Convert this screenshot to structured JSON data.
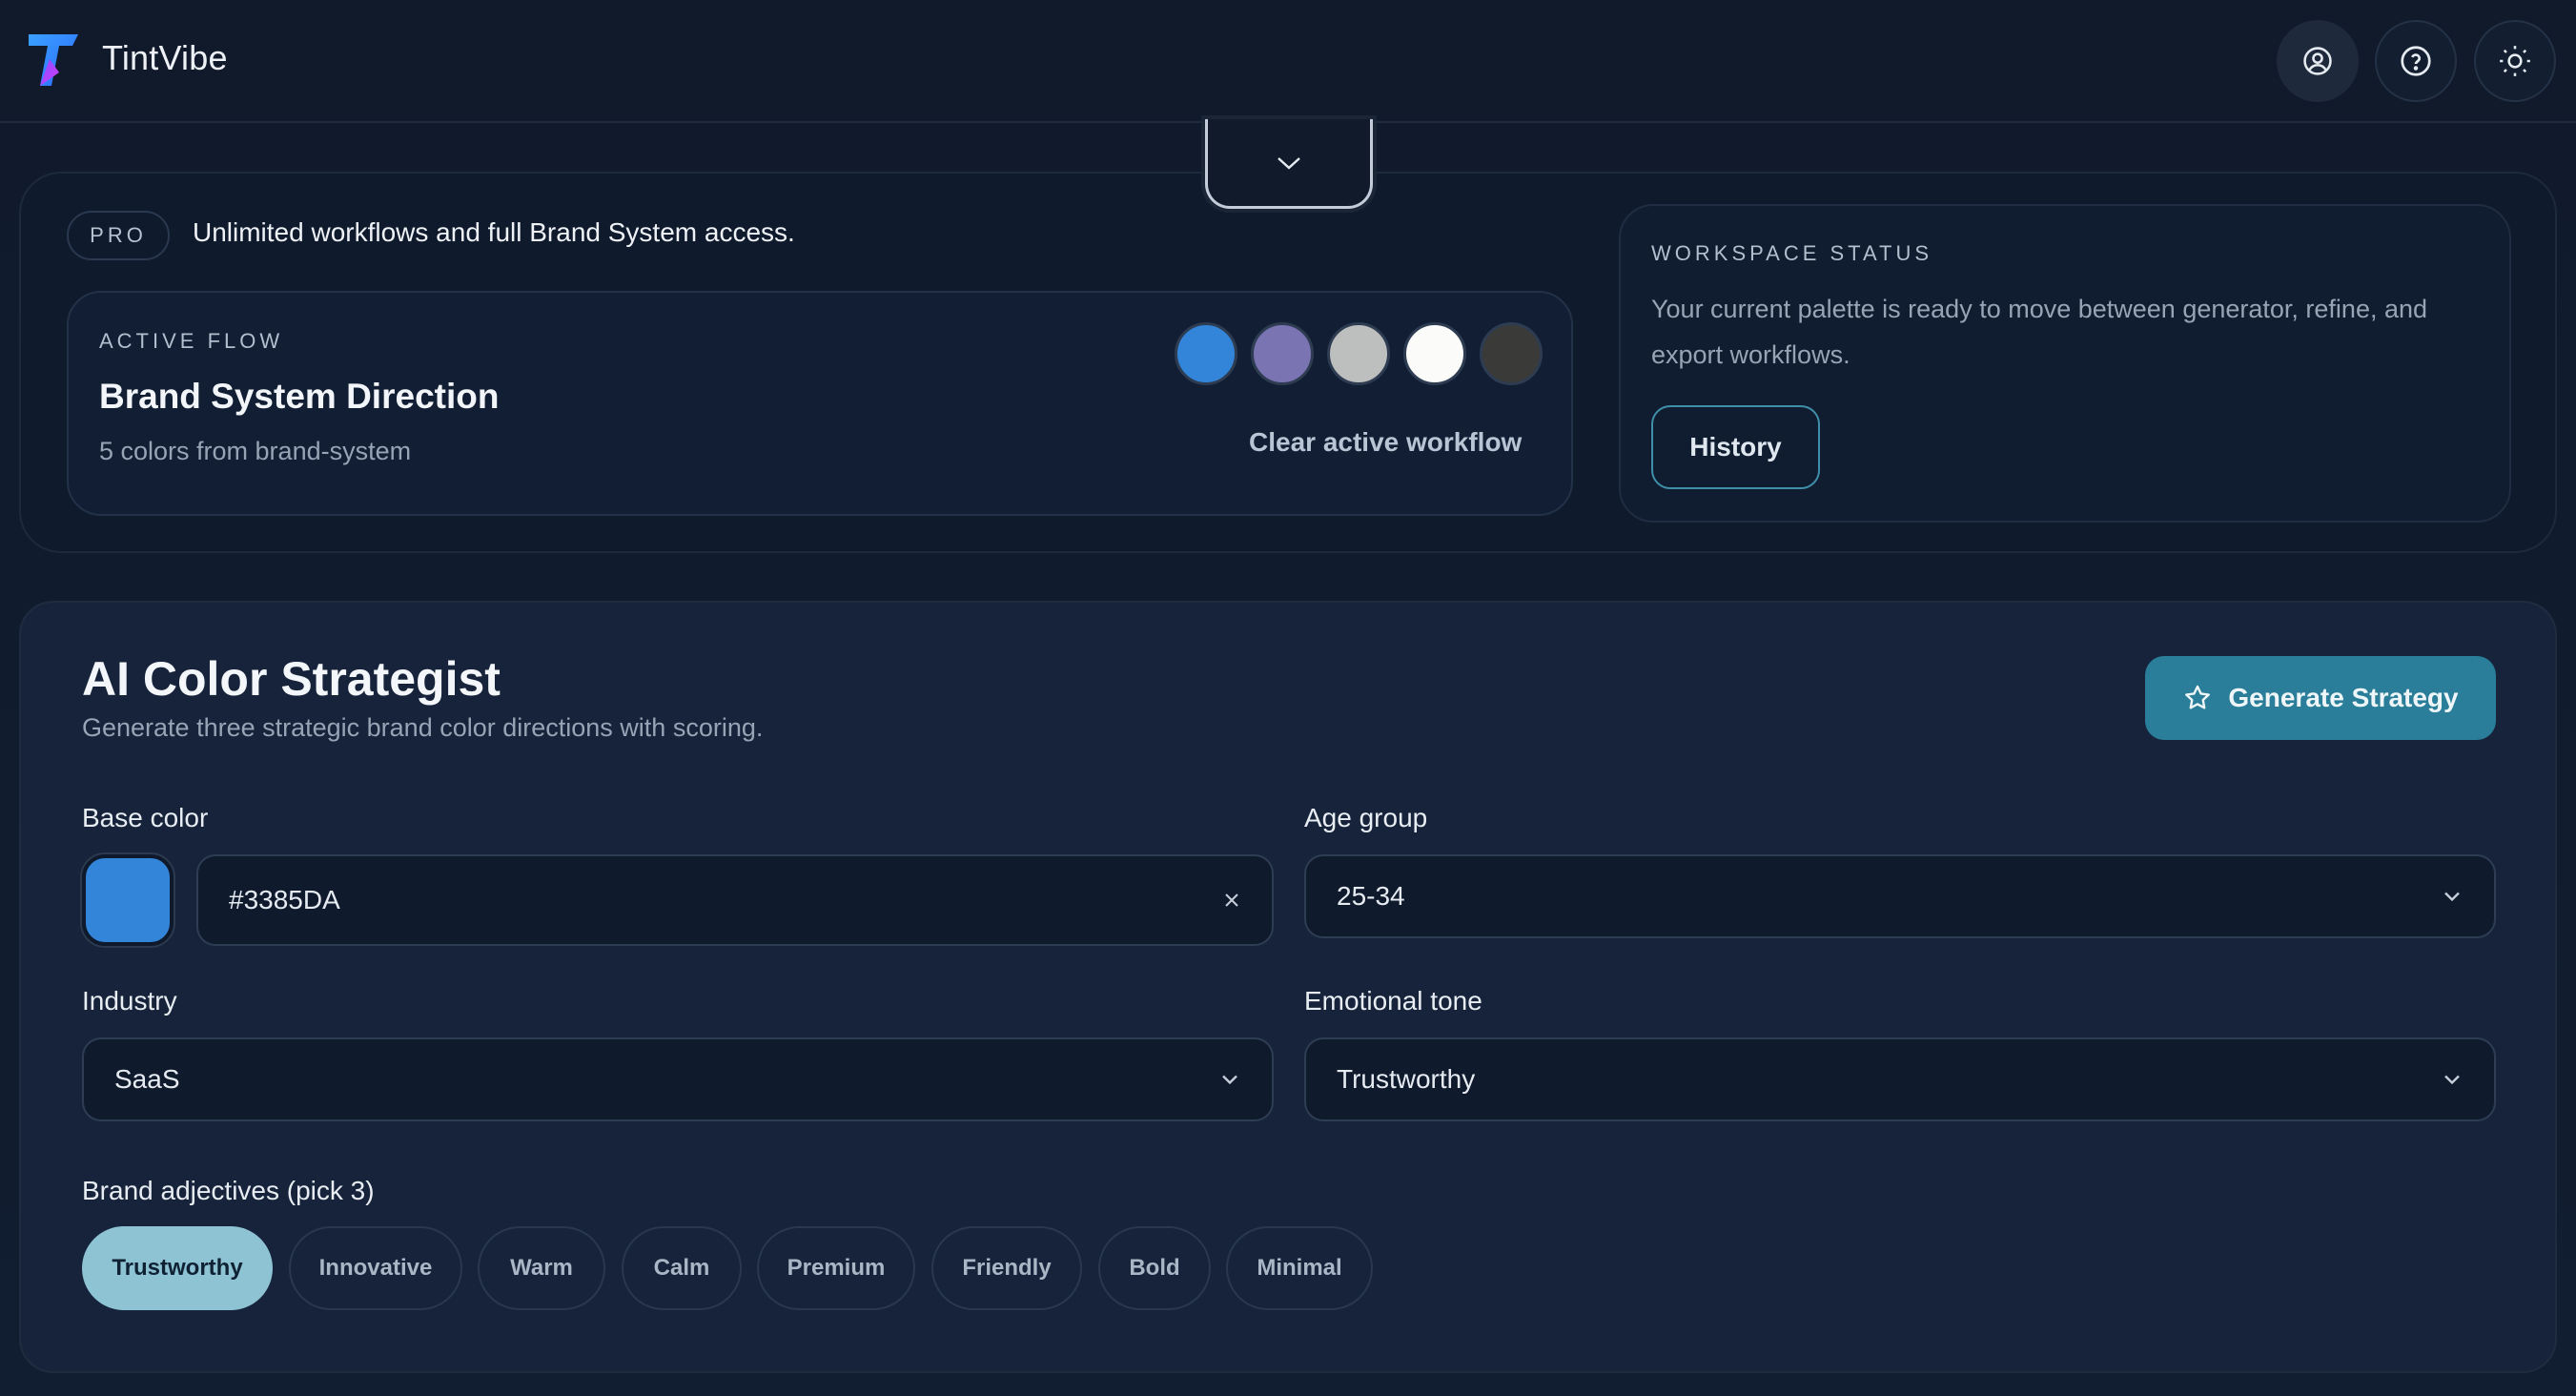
{
  "header": {
    "brand": "TintVibe",
    "icons": [
      "user-icon",
      "help-icon",
      "sun-icon"
    ]
  },
  "top": {
    "plan_badge": "PRO",
    "plan_text": "Unlimited workflows and full Brand System access.",
    "active_flow": {
      "eyebrow": "ACTIVE FLOW",
      "title": "Brand System Direction",
      "subtitle": "5 colors from brand-system",
      "swatches": [
        "#3385DA",
        "#7B74B3",
        "#BDBEBE",
        "#FBFBFA",
        "#3A3A38"
      ],
      "clear_label": "Clear active workflow"
    },
    "workspace": {
      "eyebrow": "WORKSPACE STATUS",
      "text": "Your current palette is ready to move between generator, refine, and export workflows.",
      "history_label": "History"
    }
  },
  "strategist": {
    "title": "AI Color Strategist",
    "subtitle": "Generate three strategic brand color directions with scoring.",
    "generate_label": "Generate Strategy",
    "base_color": {
      "label": "Base color",
      "value": "#3385DA"
    },
    "age_group": {
      "label": "Age group",
      "value": "25-34"
    },
    "industry": {
      "label": "Industry",
      "value": "SaaS"
    },
    "emotional_tone": {
      "label": "Emotional tone",
      "value": "Trustworthy"
    },
    "adjectives": {
      "label": "Brand adjectives (pick 3)",
      "items": [
        "Trustworthy",
        "Innovative",
        "Warm",
        "Calm",
        "Premium",
        "Friendly",
        "Bold",
        "Minimal"
      ],
      "selected": "Trustworthy"
    }
  },
  "colors": {
    "accent": "#2A7E99",
    "chip_selected": "#8EC3D4",
    "background": "#0F1A2B"
  }
}
